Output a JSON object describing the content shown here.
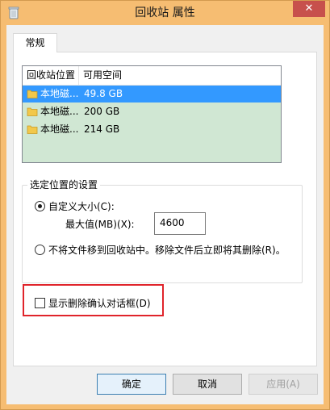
{
  "window": {
    "title": "回收站 属性",
    "close_label": "✕"
  },
  "tabs": [
    {
      "label": "常规"
    }
  ],
  "list": {
    "columns": [
      "回收站位置",
      "可用空间"
    ],
    "rows": [
      {
        "location": "本地磁...",
        "space": "49.8 GB",
        "selected": true
      },
      {
        "location": "本地磁...",
        "space": "200 GB",
        "selected": false
      },
      {
        "location": "本地磁...",
        "space": "214 GB",
        "selected": false
      }
    ]
  },
  "settings": {
    "group_title": "选定位置的设置",
    "custom_size_label": "自定义大小(C):",
    "max_value_label": "最大值(MB)(X):",
    "max_value": "4600",
    "no_recycle_label": "不将文件移到回收站中。移除文件后立即将其删除(R)。"
  },
  "confirm_checkbox": {
    "label": "显示删除确认对话框(D)",
    "checked": false
  },
  "buttons": {
    "ok": "确定",
    "cancel": "取消",
    "apply": "应用(A)"
  },
  "colors": {
    "title_bar": "#f6bd72",
    "close_button": "#c7504c",
    "list_background": "#d0e7d3",
    "selection": "#3399ff",
    "highlight_box": "#e0242b"
  },
  "icons": {
    "app": "recycle-bin-icon",
    "folder": "folder-icon"
  }
}
